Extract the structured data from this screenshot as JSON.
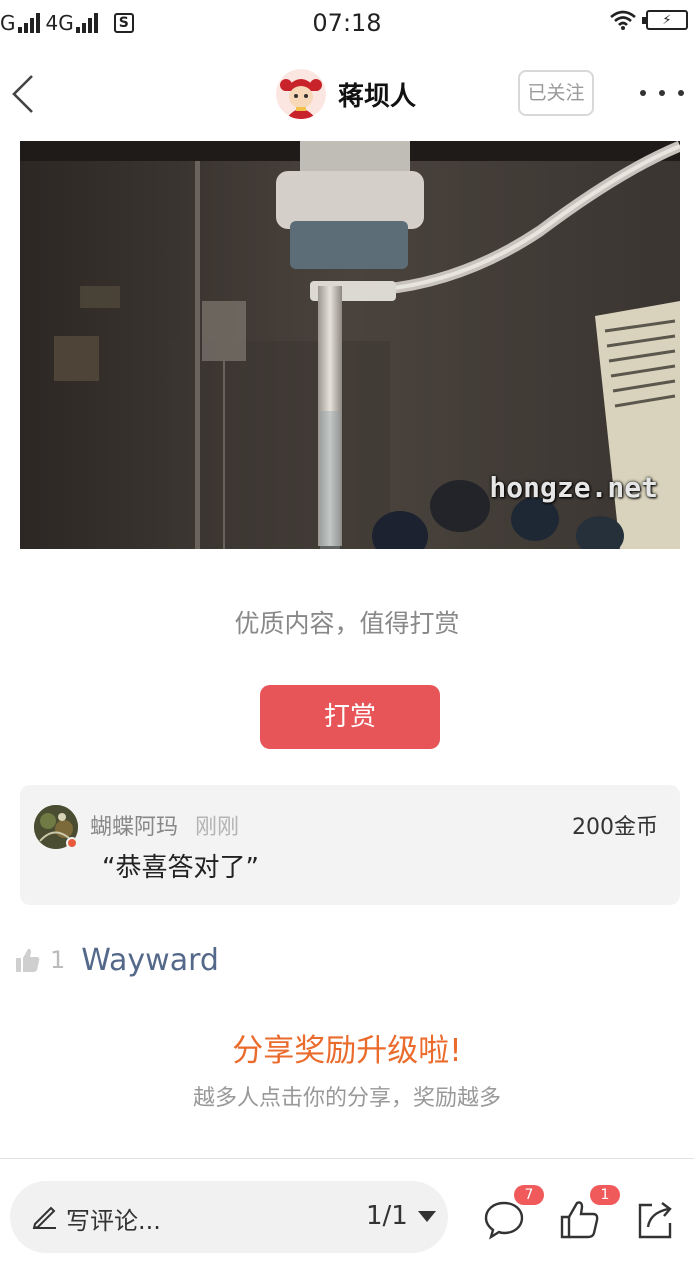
{
  "status_bar": {
    "carrier_left": "G",
    "network": "4G",
    "sim_icon": "S",
    "time": "07:18"
  },
  "header": {
    "author_name": "蒋坝人",
    "follow_label": "已关注"
  },
  "media": {
    "watermark": "hongze.net"
  },
  "reward": {
    "prompt": "优质内容，值得打赏",
    "button_label": "打赏"
  },
  "reward_record": {
    "user": "蝴蝶阿玛",
    "time": "刚刚",
    "amount": "200金币",
    "message": "“恭喜答对了”"
  },
  "likes": {
    "count": "1",
    "user": "Wayward"
  },
  "share_promo": {
    "title": "分享奖励升级啦!",
    "subtitle": "越多人点击你的分享，奖励越多"
  },
  "bottom_bar": {
    "comment_placeholder": "写评论...",
    "page_indicator": "1/1",
    "comment_badge": "7",
    "like_badge": "1"
  },
  "colors": {
    "reward_button": "#e85558",
    "share_title": "#ea6b2c",
    "liker_name": "#54698a",
    "badge": "#f05a5a"
  }
}
